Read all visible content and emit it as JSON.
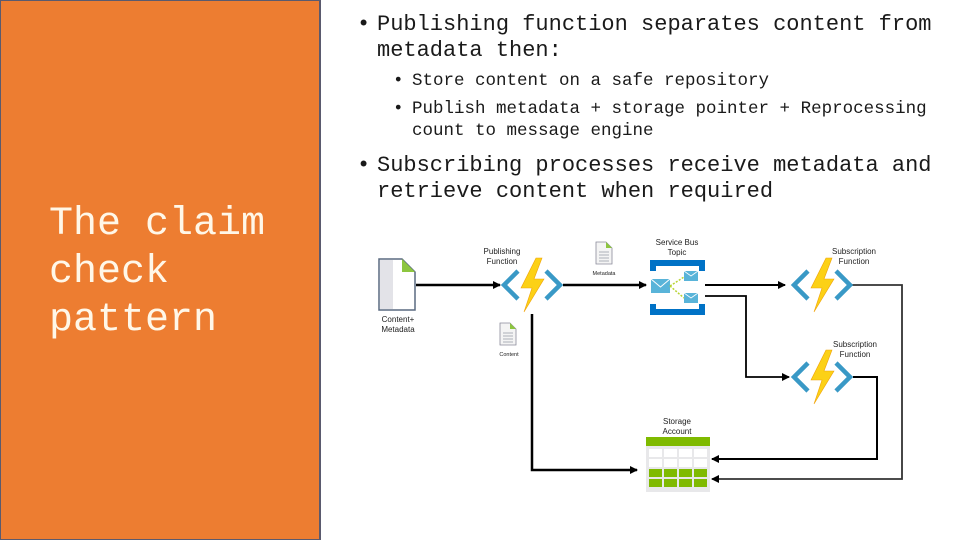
{
  "slide": {
    "title": "The claim\ncheck\npattern",
    "accent_color": "#ed7d31",
    "bullets": [
      {
        "text": "Publishing function separates content from metadata then:",
        "sub": [
          "Store content on a safe repository",
          "Publish metadata + storage pointer + Reprocessing count to message engine"
        ]
      },
      {
        "text": "Subscribing processes receive metadata and retrieve content when required",
        "sub": []
      }
    ]
  },
  "diagram": {
    "nodes": {
      "source_doc": {
        "label_line1": "Content+",
        "label_line2": "Metadata",
        "icon": "document-icon"
      },
      "publishing_function": {
        "label_line1": "Publishing",
        "label_line2": "Function",
        "icon": "azure-function-icon"
      },
      "metadata_doc": {
        "label": "Metadata",
        "icon": "document-icon"
      },
      "content_doc": {
        "label": "Content",
        "icon": "document-icon"
      },
      "service_bus": {
        "label_line1": "Service Bus",
        "label_line2": "Topic",
        "icon": "service-bus-topic-icon"
      },
      "subscription_function_1": {
        "label_line1": "Subscription",
        "label_line2": "Function",
        "icon": "azure-function-icon"
      },
      "subscription_function_2": {
        "label_line1": "Subscription",
        "label_line2": "Function",
        "icon": "azure-function-icon"
      },
      "storage_account": {
        "label_line1": "Storage",
        "label_line2": "Account",
        "icon": "storage-table-icon"
      }
    },
    "edges": [
      {
        "from": "Content+Metadata",
        "to": "Publishing Function"
      },
      {
        "from": "Publishing Function",
        "to": "Service Bus Topic",
        "carries": "Metadata"
      },
      {
        "from": "Publishing Function",
        "to": "Storage Account",
        "carries": "Content"
      },
      {
        "from": "Service Bus Topic",
        "to": "Subscription Function 1"
      },
      {
        "from": "Service Bus Topic",
        "to": "Subscription Function 2"
      },
      {
        "from": "Subscription Function 1",
        "to": "Storage Account"
      },
      {
        "from": "Subscription Function 2",
        "to": "Storage Account"
      }
    ],
    "colors": {
      "function_bracket": "#3999c6",
      "bolt": "#fcd116",
      "bolt_dark": "#f0a30a",
      "doc_fold": "#8dc63f",
      "service_bus": "#0072c6",
      "envelope": "#59b4d9",
      "storage_green": "#7fba00",
      "line": "#000000"
    }
  }
}
